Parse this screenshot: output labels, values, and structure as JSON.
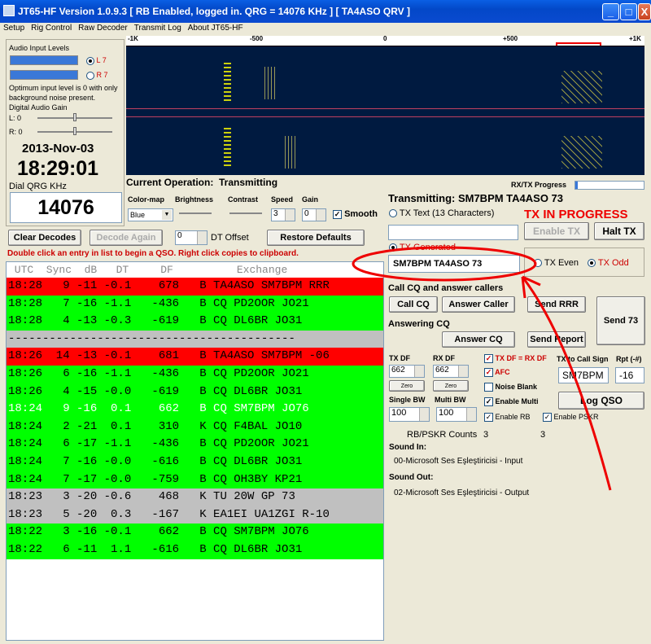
{
  "window": {
    "title": "JT65-HF Version 1.0.9.3  [ RB Enabled, logged in.  QRG = 14076 KHz ] [ TA4ASO QRV ]",
    "min": "_",
    "max": "□",
    "close": "X"
  },
  "menu": [
    "Setup",
    "Rig Control",
    "Raw Decoder",
    "Transmit Log",
    "About JT65-HF"
  ],
  "scale": {
    "m1k": "-1K",
    "m500": "-500",
    "zero": "0",
    "p500": "+500",
    "p1k": "+1K"
  },
  "audio": {
    "title": "Audio Input Levels",
    "l": "L 7",
    "r": "R 7",
    "note": "Optimum input level is 0 with only background noise present.",
    "gain": "Digital Audio Gain",
    "lgain": "L: 0",
    "rgain": "R: 0"
  },
  "clock": {
    "date": "2013-Nov-03",
    "time": "18:29:01",
    "qrg_label": "Dial QRG KHz",
    "qrg": "14076"
  },
  "operation": {
    "label": "Current Operation:",
    "value": "Transmitting",
    "rxtx": "RX/TX Progress"
  },
  "controls": {
    "colormap": "Color-map",
    "colorval": "Blue",
    "brightness": "Brightness",
    "contrast": "Contrast",
    "speed": "Speed",
    "speedval": "3",
    "gain": "Gain",
    "gainval": "0",
    "smooth": "Smooth"
  },
  "buttons": {
    "clear": "Clear Decodes",
    "again": "Decode Again",
    "dt_val": "0",
    "dt_label": "DT Offset",
    "restore": "Restore Defaults"
  },
  "hint": "Double click an entry in list to begin a QSO.  Right click copies to clipboard.",
  "header": " UTC  Sync  dB   DT     DF          Exchange",
  "rows": [
    {
      "t": "18:28   9 -11 -0.1    678   B TA4ASO SM7BPM RRR",
      "c": "#ff0000",
      "f": "#000"
    },
    {
      "t": "18:28   7 -16 -1.1   -436   B CQ PD2OOR JO21",
      "c": "#00ff00",
      "f": "#000"
    },
    {
      "t": "18:28   4 -13 -0.3   -619   B CQ DL6BR JO31",
      "c": "#00ff00",
      "f": "#000"
    },
    {
      "t": "------------------------------------------",
      "c": "#c0c0c0",
      "f": "#000"
    },
    {
      "t": "18:26  14 -13 -0.1    681   B TA4ASO SM7BPM -06",
      "c": "#ff0000",
      "f": "#000"
    },
    {
      "t": "18:26   6 -16 -1.1   -436   B CQ PD2OOR JO21",
      "c": "#00ff00",
      "f": "#000"
    },
    {
      "t": "18:26   4 -15 -0.0   -619   B CQ DL6BR JO31",
      "c": "#00ff00",
      "f": "#000"
    },
    {
      "t": "18:24   9 -16  0.1    662   B CQ SM7BPM JO76",
      "c": "#00ff00",
      "f": "#fff"
    },
    {
      "t": "18:24   2 -21  0.1    310   K CQ F4BAL JO10",
      "c": "#00ff00",
      "f": "#000"
    },
    {
      "t": "18:24   6 -17 -1.1   -436   B CQ PD2OOR JO21",
      "c": "#00ff00",
      "f": "#000"
    },
    {
      "t": "18:24   7 -16 -0.0   -616   B CQ DL6BR JO31",
      "c": "#00ff00",
      "f": "#000"
    },
    {
      "t": "18:24   7 -17 -0.0   -759   B CQ OH3BY KP21",
      "c": "#00ff00",
      "f": "#000"
    },
    {
      "t": "18:23   3 -20 -0.6    468   K TU 20W GP 73",
      "c": "#c0c0c0",
      "f": "#000"
    },
    {
      "t": "18:23   5 -20  0.3   -167   K EA1EI UA1ZGI R-10",
      "c": "#c0c0c0",
      "f": "#000"
    },
    {
      "t": "18:22   3 -16 -0.1    662   B CQ SM7BPM JO76",
      "c": "#00ff00",
      "f": "#000"
    },
    {
      "t": "18:22   6 -11  1.1   -616   B CQ DL6BR JO31",
      "c": "#00ff00",
      "f": "#000"
    }
  ],
  "tx": {
    "transmitting": "Transmitting: SM7BPM TA4ASO 73",
    "txtext": "TX Text (13 Characters)",
    "progress": "TX IN PROGRESS",
    "enable": "Enable TX",
    "halt": "Halt TX",
    "generated": "TX Generated",
    "msg": "SM7BPM TA4ASO 73",
    "even": "TX Even",
    "odd": "TX Odd"
  },
  "cq": {
    "label": "Call CQ and answer callers",
    "callcq": "Call CQ",
    "answer": "Answer Caller",
    "rrr": "Send RRR",
    "send73": "Send 73",
    "answering": "Answering CQ",
    "answercq": "Answer CQ",
    "report": "Send Report"
  },
  "df": {
    "txdf": "TX DF",
    "txval": "662",
    "rxdf": "RX DF",
    "rxval": "662",
    "zero": "Zero",
    "txeqrx": "TX DF = RX DF",
    "afc": "AFC",
    "noise": "Noise Blank",
    "single": "Single BW",
    "singleval": "100",
    "multi": "Multi BW",
    "multival": "100",
    "enmulti": "Enable Multi",
    "enrb": "Enable RB",
    "enpskr": "Enable PSKR",
    "tocall": "TX to Call Sign",
    "tocallval": "SM7BPM",
    "rpt": "Rpt (-#)",
    "rptval": "-16",
    "log": "Log QSO"
  },
  "counts": {
    "label": "RB/PSKR Counts",
    "rb": "3",
    "pskr": "3"
  },
  "sound": {
    "in": "Sound In:",
    "inval": "00-Microsoft Ses Eşleştiricisi - Input",
    "out": "Sound Out:",
    "outval": "02-Microsoft Ses Eşleştiricisi - Output"
  }
}
